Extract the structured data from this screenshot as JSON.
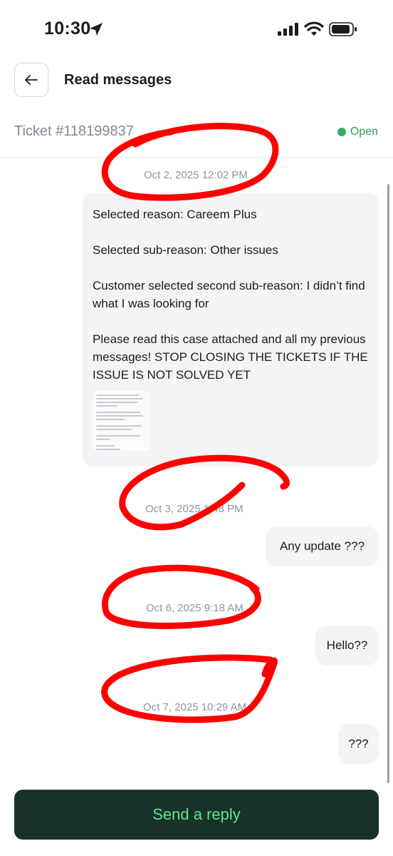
{
  "status_bar": {
    "time": "10:30",
    "icons": [
      "location-arrow-icon",
      "cellular-signal-icon",
      "wifi-icon",
      "battery-icon"
    ]
  },
  "header": {
    "back_icon": "arrow-left-icon",
    "title": "Read messages"
  },
  "ticket": {
    "id_label": "Ticket #118199837",
    "status": "Open",
    "status_color": "#3aa865"
  },
  "messages": [
    {
      "timestamp": "Oct 2, 2025 12:02 PM",
      "paragraphs": [
        "Selected reason: Careem Plus",
        "Selected sub-reason: Other issues",
        "Customer selected second sub-reason: I didn’t find what I was looking for",
        "Please read this case attached and all my previous messages! STOP CLOSING THE TICKETS IF THE ISSUE IS NOT SOLVED YET"
      ],
      "attachment": "image-attachment-thumbnail"
    },
    {
      "timestamp": "Oct 3, 2025 1:48 PM",
      "text": "Any update ???"
    },
    {
      "timestamp": "Oct 6, 2025 9:18 AM",
      "text": "Hello??"
    },
    {
      "timestamp": "Oct 7, 2025 10:29 AM",
      "text": "???"
    }
  ],
  "annotation_color": "#ff0000",
  "reply_button": {
    "label": "Send a reply",
    "background": "#18312b",
    "text_color": "#5ee68a"
  }
}
